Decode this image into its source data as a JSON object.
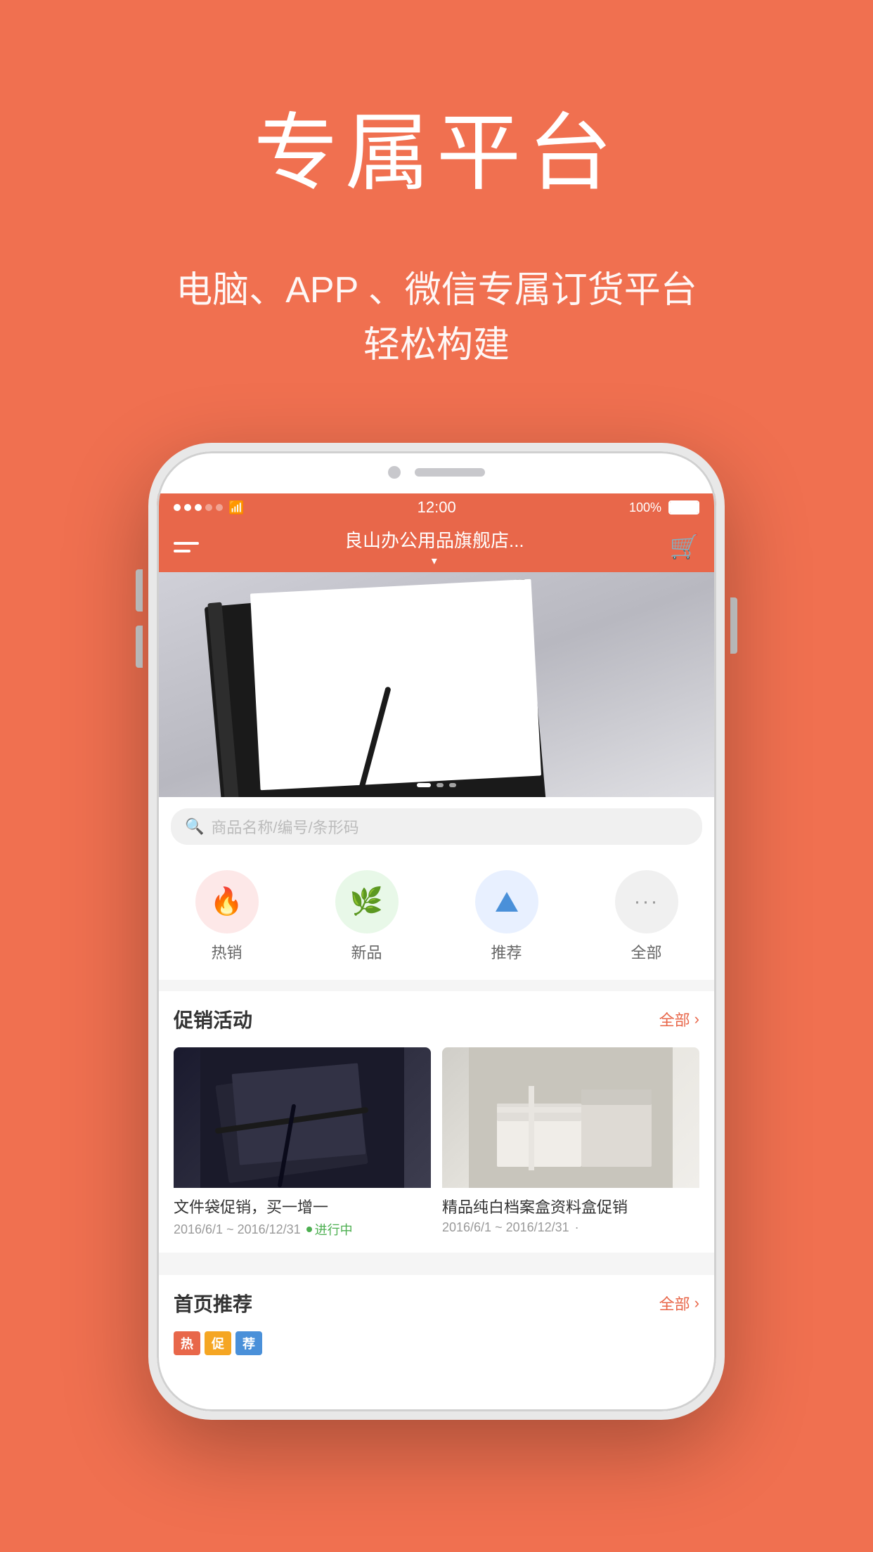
{
  "page": {
    "background_color": "#F07050",
    "main_title": "专属平台",
    "sub_title_line1": "电脑、APP 、微信专属订货平台",
    "sub_title_line2": "轻松构建"
  },
  "phone": {
    "status_bar": {
      "time": "12:00",
      "battery": "100%",
      "signal_dots": [
        "filled",
        "filled",
        "filled",
        "empty",
        "empty"
      ]
    },
    "header": {
      "store_name": "良山办公用品旗舰店...",
      "store_name_arrow": "▾"
    },
    "search": {
      "placeholder": "商品名称/编号/条形码"
    },
    "categories": [
      {
        "id": "hot",
        "label": "热销",
        "icon": "🔥",
        "color": "#fde8e8"
      },
      {
        "id": "new",
        "label": "新品",
        "icon": "🌿",
        "color": "#e8f8e8"
      },
      {
        "id": "recommend",
        "label": "推荐",
        "icon": "▲",
        "color": "#e8f0ff"
      },
      {
        "id": "all",
        "label": "全部",
        "icon": "···",
        "color": "#f0f0f0"
      }
    ],
    "promo_section": {
      "title": "促销活动",
      "more_label": "全部",
      "items": [
        {
          "name": "文件袋促销，买一增一",
          "date": "2016/6/1 ~ 2016/12/31",
          "status": "进行中",
          "status_color": "#4caf50"
        },
        {
          "name": "精品纯白档案盒资料盒促销",
          "date": "2016/6/1 ~ 2016/12/31",
          "status": "·",
          "status_color": "#999"
        }
      ]
    },
    "recommend_section": {
      "title": "首页推荐",
      "more_label": "全部",
      "tags": [
        "热",
        "促",
        "荐"
      ]
    }
  }
}
